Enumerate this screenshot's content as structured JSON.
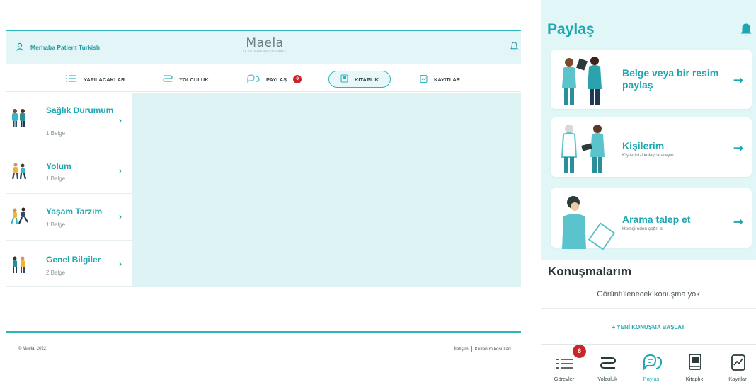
{
  "desktop": {
    "greeting": "Merhaba Patient Turkish",
    "logo": "Maela",
    "logo_tagline": "LA VIE SOUS SURVEILLANCE",
    "nav": [
      {
        "label": "YAPILACAKLAR",
        "icon": "list-icon"
      },
      {
        "label": "YOLCULUK",
        "icon": "journey-icon"
      },
      {
        "label": "PAYLAŞ",
        "icon": "share-chat-icon",
        "badge": "0"
      },
      {
        "label": "KITAPLIK",
        "icon": "book-icon",
        "active": true
      },
      {
        "label": "KAYITLAR",
        "icon": "records-icon"
      }
    ],
    "library": [
      {
        "title": "Sağlık Durumum",
        "count": "1 Belge"
      },
      {
        "title": "Yolum",
        "count": "1 Belge"
      },
      {
        "title": "Yaşam Tarzım",
        "count": "1 Belge"
      },
      {
        "title": "Genel Bilgiler",
        "count": "2 Belge"
      }
    ],
    "footer": {
      "copyright": "© Maela, 2022",
      "contact": "İletişim",
      "terms": "Kullanım koşulları"
    }
  },
  "mobile": {
    "title": "Paylaş",
    "cards": [
      {
        "title": "Belge veya bir resim paylaş",
        "subtitle": ""
      },
      {
        "title": "Kişilerim",
        "subtitle": "Kişilerinizi kolayca arayın"
      },
      {
        "title": "Arama talep et",
        "subtitle": "Hemşireden çağrı al"
      }
    ],
    "conversations_heading": "Konuşmalarım",
    "empty_text": "Görüntülenecek konuşma yok",
    "new_conversation": "+ YENİ KONUŞMA BAŞLAT",
    "tabs": [
      {
        "label": "Görevler",
        "icon": "list-icon",
        "badge": "6"
      },
      {
        "label": "Yolculuk",
        "icon": "journey-icon"
      },
      {
        "label": "Paylaş",
        "icon": "share-chat-icon",
        "active": true
      },
      {
        "label": "Kitaplık",
        "icon": "book-icon"
      },
      {
        "label": "Kayıtlar",
        "icon": "records-icon"
      }
    ]
  },
  "colors": {
    "accent": "#1fa7b1",
    "light_bg": "#e1f6f6",
    "badge": "#c8262b"
  }
}
